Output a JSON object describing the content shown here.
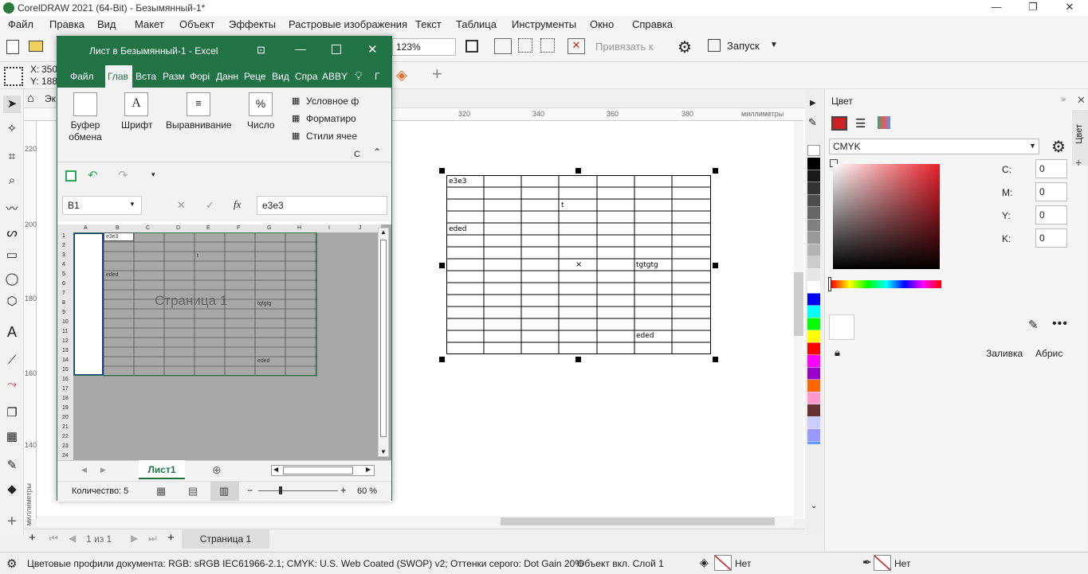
{
  "app": {
    "title": "CorelDRAW 2021 (64-Bit) - Безымянный-1*",
    "minimize": "—",
    "restore": "❐",
    "close": "✕"
  },
  "menu": {
    "items": [
      "Файл",
      "Правка",
      "Вид",
      "Макет",
      "Объект",
      "Эффекты",
      "Растровые изображения",
      "Текст",
      "Таблица",
      "Инструменты",
      "Окно",
      "Справка"
    ]
  },
  "toolbar": {
    "zoom_value": "123%",
    "snap_label": "Привязать к",
    "launch_label": "Запуск"
  },
  "propbar": {
    "x_label": "X:",
    "x_value": "350",
    "y_label": "Y:",
    "y_value": "188"
  },
  "tab": {
    "home_label": "Эк"
  },
  "ruler": {
    "h_ticks": [
      "320",
      "340",
      "360",
      "380"
    ],
    "h_unit": "миллиметры",
    "v_ticks": [
      "220",
      "200",
      "180",
      "160",
      "140"
    ],
    "v_unit": "миллиметры"
  },
  "table_object": {
    "cells": [
      {
        "text": "e3e3"
      },
      {
        "text": "t"
      },
      {
        "text": "eded"
      },
      {
        "text": "×"
      },
      {
        "text": "tgtgtg"
      },
      {
        "text": "eded"
      }
    ]
  },
  "pagebar": {
    "page_count": "1 из 1",
    "page_tab": "Страница 1"
  },
  "statusbar": {
    "profiles": "Цветовые профили документа: RGB: sRGB IEC61966-2.1; CMYK: U.S. Web Coated (SWOP) v2; Оттенки серого: Dot Gain 20%",
    "object_info": "Объект вкл.  Слой 1",
    "fill_none": "Нет",
    "outline_none": "Нет"
  },
  "docker": {
    "title": "Цвет",
    "side_tab": "Цвет",
    "model": "CMYK",
    "c_label": "C:",
    "c_value": "0",
    "m_label": "M:",
    "m_value": "0",
    "y_label": "Y:",
    "y_value": "0",
    "k_label": "K:",
    "k_value": "0",
    "fill_button": "Заливка",
    "outline_button": "Абрис"
  },
  "palette": {
    "colors": [
      "#ffffff",
      "#000000",
      "#1a1a1a",
      "#333333",
      "#4d4d4d",
      "#666666",
      "#808080",
      "#999999",
      "#b3b3b3",
      "#cccccc",
      "#e6e6e6",
      "#ffffff",
      "#0000ff",
      "#00ffff",
      "#00ff00",
      "#ffff00",
      "#ff0000",
      "#ff00ff",
      "#9900cc",
      "#ff6600",
      "#ff99cc",
      "#663333",
      "#ccccff",
      "#9999ff",
      "#6699ff",
      "#3366cc",
      "#333399"
    ]
  },
  "excel": {
    "title": "Лист в Безымянный-1  -  Excel",
    "tabs": [
      "Файл",
      "Глав",
      "Вста",
      "Разм",
      "Форі",
      "Данн",
      "Реце",
      "Вид",
      "Спра",
      "ABBY",
      "Г"
    ],
    "ribbon": {
      "clipboard": "Буфер обмена",
      "font": "Шрифт",
      "align": "Выравнивание",
      "number": "Число",
      "cond_format": "Условное ф",
      "format_table": "Форматиро",
      "cell_styles": "Стили ячее",
      "group_tail": "С"
    },
    "name_box": "B1",
    "formula_value": "e3e3",
    "fx": "fx",
    "columns": [
      "A",
      "B",
      "C",
      "D",
      "E",
      "F",
      "G",
      "H",
      "I",
      "J"
    ],
    "rows": [
      "1",
      "2",
      "3",
      "4",
      "5",
      "6",
      "7",
      "8",
      "9",
      "10",
      "11",
      "12",
      "13",
      "14",
      "15",
      "16",
      "17",
      "18",
      "19",
      "20",
      "21",
      "22",
      "23",
      "24"
    ],
    "cells": {
      "b1": "e3e3",
      "e3": "t",
      "b5": "eded",
      "g8": "tgtgtg",
      "g14": "eded"
    },
    "page_watermark": "Страница 1",
    "sheet_tab": "Лист1",
    "status_count": "Количество: 5",
    "zoom": "60 %"
  },
  "colors": {
    "excel_green": "#217346",
    "corel_red": "#cc2222"
  }
}
